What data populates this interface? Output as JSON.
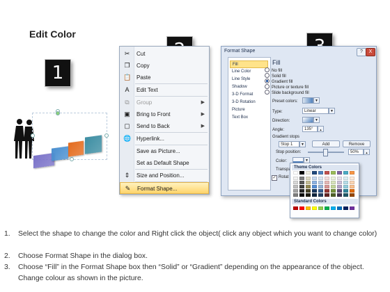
{
  "page_title": "Edit Color",
  "step_badges": [
    "1",
    "2",
    "3"
  ],
  "context_menu": {
    "items": [
      {
        "label": "Cut",
        "icon": "scissors-icon",
        "glyph": "✂",
        "disabled": false,
        "submenu": false
      },
      {
        "label": "Copy",
        "icon": "copy-icon",
        "glyph": "❐",
        "disabled": false,
        "submenu": false
      },
      {
        "label": "Paste",
        "icon": "paste-icon",
        "glyph": "📋",
        "disabled": false,
        "submenu": false
      },
      {
        "label": "Edit Text",
        "icon": "edit-text-icon",
        "glyph": "A",
        "disabled": false,
        "submenu": false
      },
      {
        "label": "Group",
        "icon": "group-icon",
        "glyph": "⧉",
        "disabled": true,
        "submenu": true
      },
      {
        "label": "Bring to Front",
        "icon": "bring-to-front-icon",
        "glyph": "▣",
        "disabled": false,
        "submenu": true
      },
      {
        "label": "Send to Back",
        "icon": "send-to-back-icon",
        "glyph": "▢",
        "disabled": false,
        "submenu": true
      },
      {
        "label": "Hyperlink...",
        "icon": "hyperlink-icon",
        "glyph": "🌐",
        "disabled": false,
        "submenu": false
      },
      {
        "label": "Save as Picture...",
        "icon": "",
        "glyph": "",
        "disabled": false,
        "submenu": false
      },
      {
        "label": "Set as Default Shape",
        "icon": "",
        "glyph": "",
        "disabled": false,
        "submenu": false
      },
      {
        "label": "Size and Position...",
        "icon": "size-position-icon",
        "glyph": "⇕",
        "disabled": false,
        "submenu": false
      },
      {
        "label": "Format Shape...",
        "icon": "format-shape-icon",
        "glyph": "✎",
        "disabled": false,
        "submenu": false,
        "highlighted": true
      }
    ]
  },
  "dialog": {
    "title": "Format Shape",
    "help": "?",
    "close": "X",
    "categories": [
      "Fill",
      "Line Color",
      "Line Style",
      "Shadow",
      "3-D Format",
      "3-D Rotation",
      "Picture",
      "Text Box"
    ],
    "selected_category": "Fill",
    "section_title": "Fill",
    "fill_options": [
      "No fill",
      "Solid fill",
      "Gradient fill",
      "Picture or texture fill",
      "Slide background fill"
    ],
    "selected_fill": "Gradient fill",
    "preset_colors_label": "Preset colors:",
    "type_label": "Type:",
    "type_value": "Linear",
    "direction_label": "Direction:",
    "angle_label": "Angle:",
    "angle_value": "135°",
    "gradient_stops_label": "Gradient stops",
    "stop_value": "Stop 1",
    "add_label": "Add",
    "remove_label": "Remove",
    "stop_position_label": "Stop position:",
    "stop_position_value": "50%",
    "color_label": "Color:",
    "transparency_label": "Transpa",
    "rotate_label": "Rotat"
  },
  "color_popup": {
    "theme_title": "Theme Colors",
    "standard_title": "Standard Colors",
    "theme_top": [
      "#ffffff",
      "#000000",
      "#eeece1",
      "#1f497d",
      "#4f81bd",
      "#c0504d",
      "#9bbb59",
      "#8064a2",
      "#4bacc6",
      "#f79646"
    ],
    "theme_shades": [
      [
        "#f2f2f2",
        "#7f7f7f",
        "#ddd9c3",
        "#c6d9f0",
        "#dbe5f1",
        "#f2dcdb",
        "#ebf1dd",
        "#e5e0ec",
        "#dbeef3",
        "#fdeada"
      ],
      [
        "#d8d8d8",
        "#595959",
        "#c4bd97",
        "#8db3e2",
        "#b8cce4",
        "#e5b9b7",
        "#d7e3bc",
        "#ccc1d9",
        "#b7dde8",
        "#fbd5b5"
      ],
      [
        "#bfbfbf",
        "#3f3f3f",
        "#938953",
        "#548dd4",
        "#95b3d7",
        "#d99694",
        "#c3d69b",
        "#b2a2c7",
        "#92cddc",
        "#fac08f"
      ],
      [
        "#a5a5a5",
        "#262626",
        "#494429",
        "#17365d",
        "#366092",
        "#953734",
        "#76923c",
        "#5f497a",
        "#31859b",
        "#e36c09"
      ],
      [
        "#7f7f7f",
        "#0c0c0c",
        "#1d1b10",
        "#0f243e",
        "#244061",
        "#632423",
        "#4f6128",
        "#3f3151",
        "#205867",
        "#974806"
      ]
    ],
    "standard": [
      "#c00000",
      "#ff0000",
      "#ffc000",
      "#ffff00",
      "#92d050",
      "#00b050",
      "#00b0f0",
      "#0070c0",
      "#002060",
      "#7030a0"
    ]
  },
  "illustration": {
    "tile_colors": [
      "#7b73c9",
      "#4a8fd0",
      "#e46c1f",
      "#3d8ea3"
    ]
  },
  "instructions": [
    {
      "num": "1.",
      "text": "Select the shape to change the color and Right click the object( click any object which you want to change color)"
    },
    {
      "num": "2.",
      "text": "Choose Format Shape in the dialog box."
    },
    {
      "num": "3.",
      "text": "Choose “Fill” in the Format Shape box then “Solid” or “Gradient” depending on the appearance of the object. Change colour as shown in the picture."
    }
  ]
}
